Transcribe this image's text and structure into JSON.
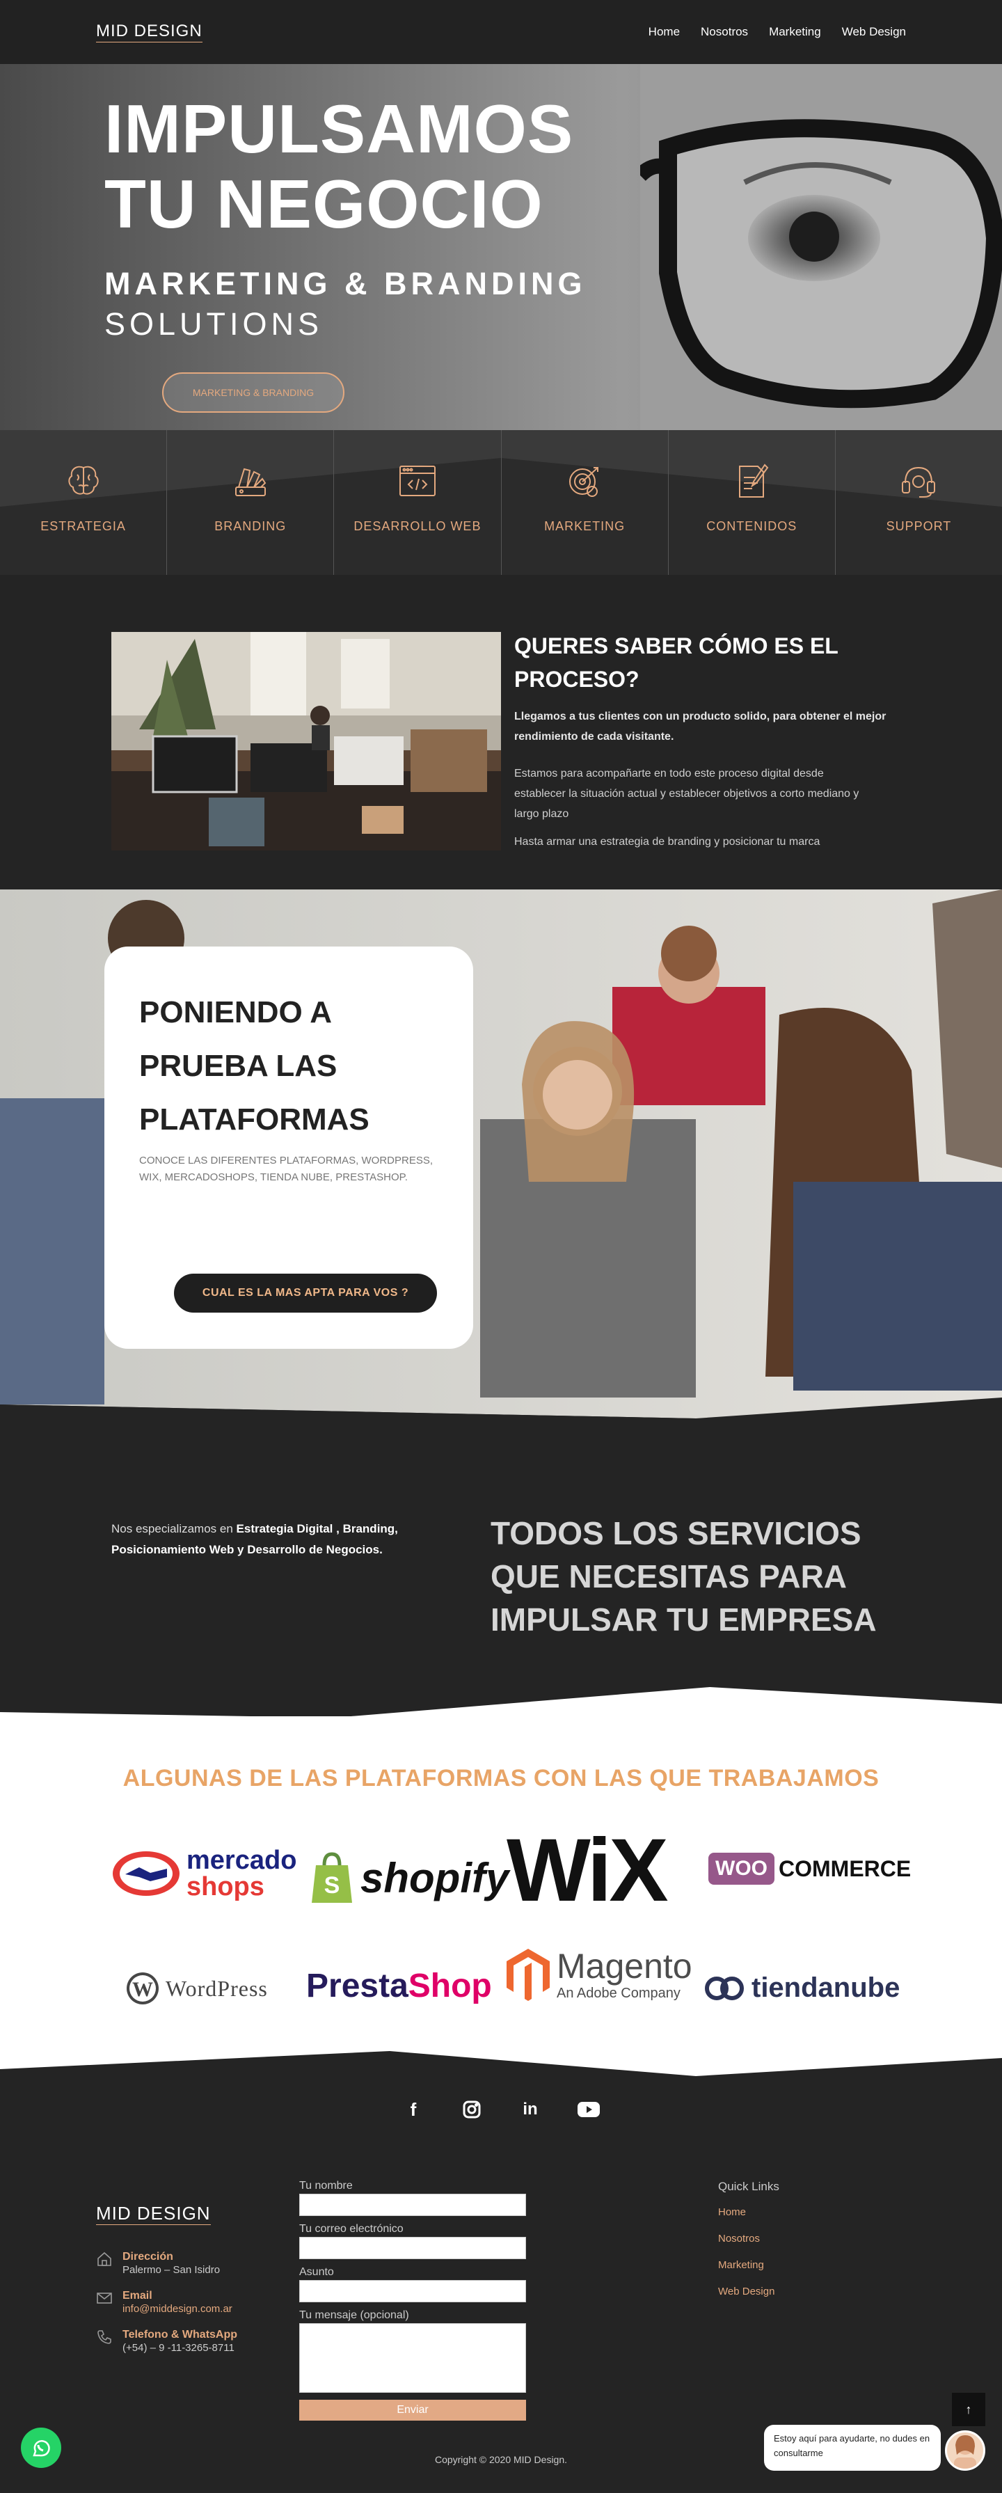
{
  "header": {
    "logo": "MID DESIGN",
    "nav": [
      "Home",
      "Nosotros",
      "Marketing",
      "Web Design"
    ]
  },
  "hero": {
    "title_line1": "IMPULSAMOS",
    "title_line2": "TU NEGOCIO",
    "subtitle1": "MARKETING & BRANDING",
    "subtitle2": "SOLUTIONS",
    "button": "MARKETING & BRANDING"
  },
  "services": [
    {
      "label": "ESTRATEGIA",
      "icon": "brain-icon"
    },
    {
      "label": "BRANDING",
      "icon": "color-swatch-icon"
    },
    {
      "label": "DESARROLLO WEB",
      "icon": "code-window-icon"
    },
    {
      "label": "MARKETING",
      "icon": "target-gear-icon"
    },
    {
      "label": "CONTENIDOS",
      "icon": "document-pen-icon"
    },
    {
      "label": "SUPPORT",
      "icon": "headset-icon"
    }
  ],
  "process": {
    "title": "QUERES SABER CÓMO ES EL PROCESO?",
    "bold": "Llegamos a tus clientes con un producto solido, para obtener el mejor rendimiento de cada visitante.",
    "p1": "Estamos para acompañarte en todo este proceso digital desde establecer la situación actual y  establecer objetivos a corto mediano y largo plazo",
    "p2": "Hasta armar una estrategia de branding y posicionar tu marca"
  },
  "testing": {
    "title": "PONIENDO A PRUEBA LAS PLATAFORMAS",
    "text": "CONOCE LAS DIFERENTES PLATAFORMAS, WORDPRESS, WIX, MERCADOSHOPS, TIENDA NUBE, PRESTASHOP.",
    "button": "CUAL ES LA MAS APTA PARA VOS ?"
  },
  "allservices": {
    "left_prefix": "Nos especializamos en ",
    "left_bold": "Estrategia Digital , Branding, Posicionamiento Web y Desarrollo de Negocios.",
    "right": "TODOS LOS SERVICIOS QUE NECESITAS PARA IMPULSAR TU EMPRESA"
  },
  "platforms": {
    "title": "ALGUNAS DE LAS PLATAFORMAS CON LAS QUE TRABAJAMOS",
    "logos": {
      "mercado": "mercado",
      "shops": "shops",
      "shopify": "shopify",
      "wix": "WiX",
      "woo": "WOO",
      "commerce": "COMMERCE",
      "wordpress": "WordPress",
      "presta1": "Presta",
      "presta2": "Shop",
      "magento": "Magento",
      "magento_sub": "An Adobe Company",
      "tiendanube": "tiendanube"
    }
  },
  "footer": {
    "social_icons": [
      "facebook-icon",
      "instagram-icon",
      "linkedin-icon",
      "youtube-icon"
    ],
    "logo": "MID DESIGN",
    "direccion_label": "Dirección",
    "direccion": "Palermo – San Isidro",
    "email_label": "Email",
    "email": "info@middesign.com.ar",
    "phone_label": "Telefono & WhatsApp",
    "phone": "(+54) – 9 -11-3265-8711",
    "form": {
      "nombre": "Tu nombre",
      "correo": "Tu correo electrónico",
      "asunto": "Asunto",
      "mensaje": "Tu mensaje (opcional)",
      "send": "Enviar"
    },
    "quick_title": "Quick Links",
    "quick_links": [
      "Home",
      "Nosotros",
      "Marketing",
      "Web Design"
    ],
    "copyright": "Copyright © 2020 MID Design.",
    "chat": "Estoy aquí para ayudarte, no dudes en consultarme",
    "to_top": "↑"
  },
  "colors": {
    "accent": "#e4a97f",
    "dark": "#242424",
    "platform_title": "#e8a466"
  }
}
